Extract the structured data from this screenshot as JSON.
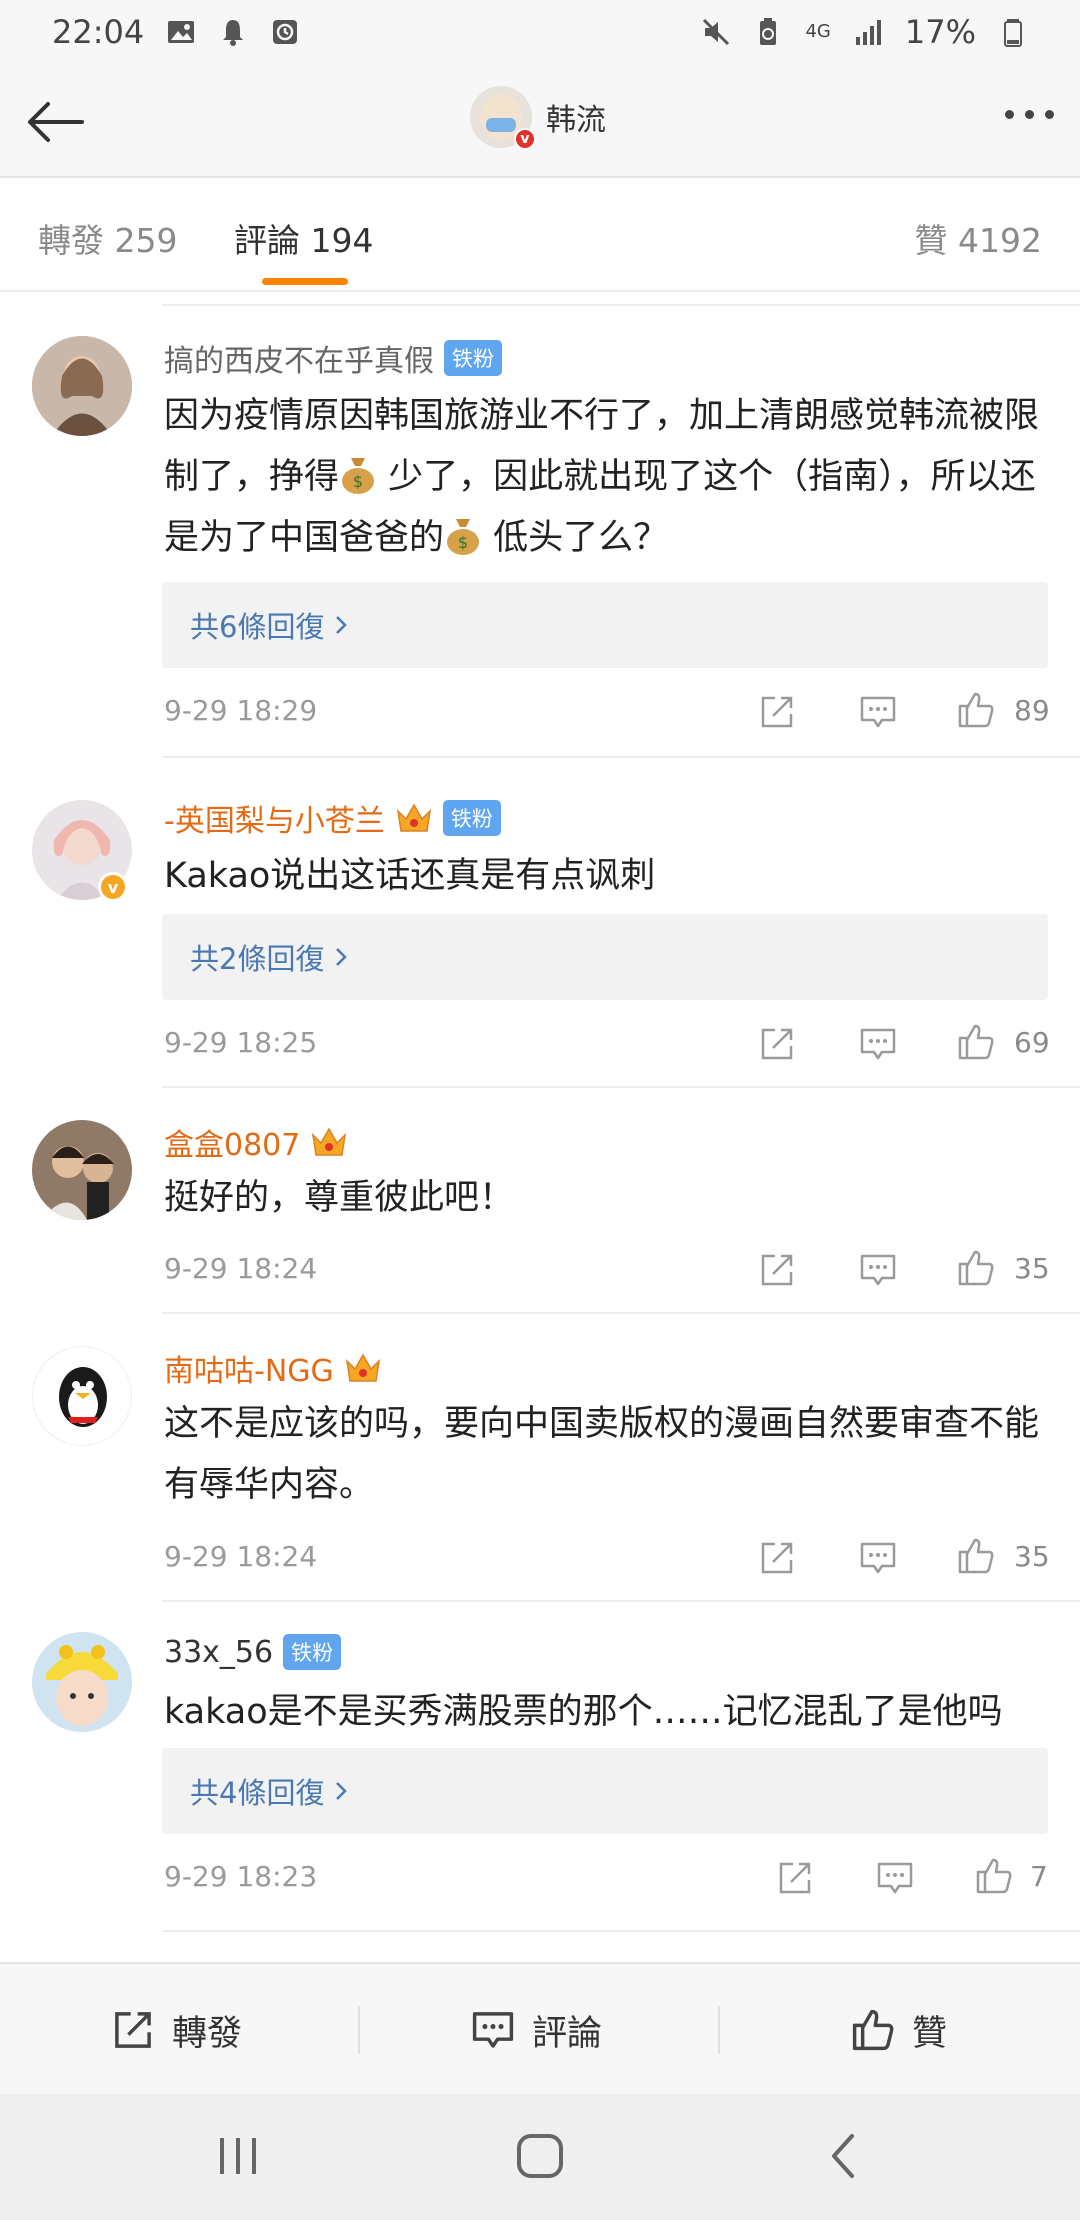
{
  "status_bar": {
    "time": "22:04",
    "network": "4G",
    "battery": "17%"
  },
  "nav": {
    "title": "韩流"
  },
  "tabs": {
    "repost": {
      "label": "轉發",
      "count": "259"
    },
    "comment": {
      "label": "評論",
      "count": "194"
    },
    "like": {
      "label": "贊",
      "count": "4192"
    }
  },
  "comments": [
    {
      "username": "搞的西皮不在乎真假",
      "badge": "铁粉",
      "text_parts": [
        "因为疫情原因韩国旅游业不行了，加上清朗感觉韩流被限制了，挣得",
        " 少了，因此就出现了这个（指南），所以还是为了中国爸爸的",
        " 低头了么？"
      ],
      "replies": "共6條回復",
      "time": "9-29 18:29",
      "likes": "89"
    },
    {
      "username": "-英国梨与小苍兰",
      "badge": "铁粉",
      "text": "Kakao说出这话还真是有点讽刺",
      "replies": "共2條回復",
      "time": "9-29 18:25",
      "likes": "69"
    },
    {
      "username": "盒盒0807",
      "text": "挺好的，尊重彼此吧！",
      "time": "9-29 18:24",
      "likes": "35"
    },
    {
      "username": "南咕咕-NGG",
      "text": "这不是应该的吗，要向中国卖版权的漫画自然要审查不能有辱华内容。",
      "time": "9-29 18:24",
      "likes": "35"
    },
    {
      "username": "33x_56",
      "badge": "铁粉",
      "text": "kakao是不是买秀满股票的那个……记忆混乱了是他吗",
      "replies": "共4條回復",
      "time": "9-29 18:23",
      "likes": "7"
    }
  ],
  "bottom_bar": {
    "repost": "轉發",
    "comment": "評論",
    "like": "贊"
  },
  "colors": {
    "accent": "#ff8200",
    "vip_name": "#e46b16",
    "link": "#4a79b2",
    "badge": "#5fa5f0"
  }
}
